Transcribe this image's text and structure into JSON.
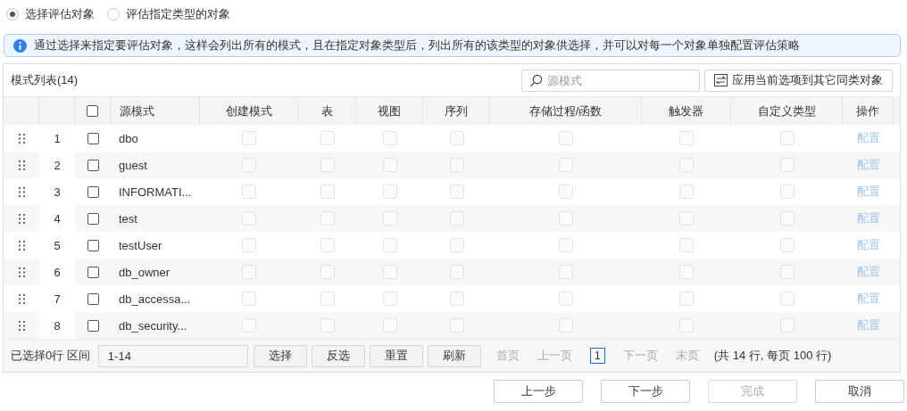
{
  "radios": [
    {
      "label": "选择评估对象",
      "selected": true
    },
    {
      "label": "评估指定类型的对象",
      "selected": false
    }
  ],
  "info": "通过选择来指定要评估对象，这样会列出所有的模式，且在指定对象类型后，列出所有的该类型的对象供选择，并可以对每一个对象单独配置评估策略",
  "panel": {
    "title": "模式列表(14)",
    "search": {
      "placeholder": "源模式"
    },
    "apply_button": "应用当前选项到其它同类对象"
  },
  "table": {
    "header_checked": false,
    "columns": [
      "源模式",
      "创建模式",
      "表",
      "视图",
      "序列",
      "存储过程/函数",
      "触发器",
      "自定义类型",
      "操作"
    ],
    "rows": [
      {
        "index": "1",
        "checked": false,
        "name": "dbo",
        "types": [
          {
            "checked": false,
            "disabled": true
          },
          {
            "checked": false,
            "disabled": true
          },
          {
            "checked": false,
            "disabled": true
          },
          {
            "checked": false,
            "disabled": true
          },
          {
            "checked": false,
            "disabled": true
          },
          {
            "checked": false,
            "disabled": true
          },
          {
            "checked": false,
            "disabled": true
          }
        ],
        "action": "配置",
        "action_disabled": true
      },
      {
        "index": "2",
        "checked": false,
        "name": "guest",
        "types": [
          {
            "checked": false,
            "disabled": true
          },
          {
            "checked": false,
            "disabled": true
          },
          {
            "checked": false,
            "disabled": true
          },
          {
            "checked": false,
            "disabled": true
          },
          {
            "checked": false,
            "disabled": true
          },
          {
            "checked": false,
            "disabled": true
          },
          {
            "checked": false,
            "disabled": true
          }
        ],
        "action": "配置",
        "action_disabled": true
      },
      {
        "index": "3",
        "checked": false,
        "name": "INFORMATI...",
        "types": [
          {
            "checked": false,
            "disabled": true
          },
          {
            "checked": false,
            "disabled": true
          },
          {
            "checked": false,
            "disabled": true
          },
          {
            "checked": false,
            "disabled": true
          },
          {
            "checked": false,
            "disabled": true
          },
          {
            "checked": false,
            "disabled": true
          },
          {
            "checked": false,
            "disabled": true
          }
        ],
        "action": "配置",
        "action_disabled": true
      },
      {
        "index": "4",
        "checked": false,
        "name": "test",
        "types": [
          {
            "checked": false,
            "disabled": true
          },
          {
            "checked": false,
            "disabled": true
          },
          {
            "checked": false,
            "disabled": true
          },
          {
            "checked": false,
            "disabled": true
          },
          {
            "checked": false,
            "disabled": true
          },
          {
            "checked": false,
            "disabled": true
          },
          {
            "checked": false,
            "disabled": true
          }
        ],
        "action": "配置",
        "action_disabled": true
      },
      {
        "index": "5",
        "checked": false,
        "name": "testUser",
        "types": [
          {
            "checked": false,
            "disabled": true
          },
          {
            "checked": false,
            "disabled": true
          },
          {
            "checked": false,
            "disabled": true
          },
          {
            "checked": false,
            "disabled": true
          },
          {
            "checked": false,
            "disabled": true
          },
          {
            "checked": false,
            "disabled": true
          },
          {
            "checked": false,
            "disabled": true
          }
        ],
        "action": "配置",
        "action_disabled": true
      },
      {
        "index": "6",
        "checked": false,
        "name": "db_owner",
        "types": [
          {
            "checked": false,
            "disabled": true
          },
          {
            "checked": false,
            "disabled": true
          },
          {
            "checked": false,
            "disabled": true
          },
          {
            "checked": false,
            "disabled": true
          },
          {
            "checked": false,
            "disabled": true
          },
          {
            "checked": false,
            "disabled": true
          },
          {
            "checked": false,
            "disabled": true
          }
        ],
        "action": "配置",
        "action_disabled": true
      },
      {
        "index": "7",
        "checked": false,
        "name": "db_accessa...",
        "types": [
          {
            "checked": false,
            "disabled": true
          },
          {
            "checked": false,
            "disabled": true
          },
          {
            "checked": false,
            "disabled": true
          },
          {
            "checked": false,
            "disabled": true
          },
          {
            "checked": false,
            "disabled": true
          },
          {
            "checked": false,
            "disabled": true
          },
          {
            "checked": false,
            "disabled": true
          }
        ],
        "action": "配置",
        "action_disabled": true
      },
      {
        "index": "8",
        "checked": false,
        "name": "db_security...",
        "types": [
          {
            "checked": false,
            "disabled": true
          },
          {
            "checked": false,
            "disabled": true
          },
          {
            "checked": false,
            "disabled": true
          },
          {
            "checked": false,
            "disabled": true
          },
          {
            "checked": false,
            "disabled": true
          },
          {
            "checked": false,
            "disabled": true
          },
          {
            "checked": false,
            "disabled": true
          }
        ],
        "action": "配置",
        "action_disabled": true
      }
    ]
  },
  "footer": {
    "selected_label": "已选择0行 区间",
    "range": "1-14",
    "buttons": [
      "选择",
      "反选",
      "重置",
      "刷新"
    ],
    "pager": [
      {
        "kind": "link",
        "label": "首页",
        "disabled": true
      },
      {
        "kind": "link",
        "label": "上一页",
        "disabled": true
      },
      {
        "kind": "page",
        "label": "1",
        "selected": true
      },
      {
        "kind": "link",
        "label": "下一页",
        "disabled": true
      },
      {
        "kind": "link",
        "label": "末页",
        "disabled": true
      }
    ],
    "summary": "(共 14 行, 每页 100 行)"
  },
  "actions": [
    {
      "label": "上一步",
      "disabled": false
    },
    {
      "label": "下一步",
      "disabled": false
    },
    {
      "label": "完成",
      "disabled": true
    },
    {
      "label": "取消",
      "disabled": false
    }
  ]
}
